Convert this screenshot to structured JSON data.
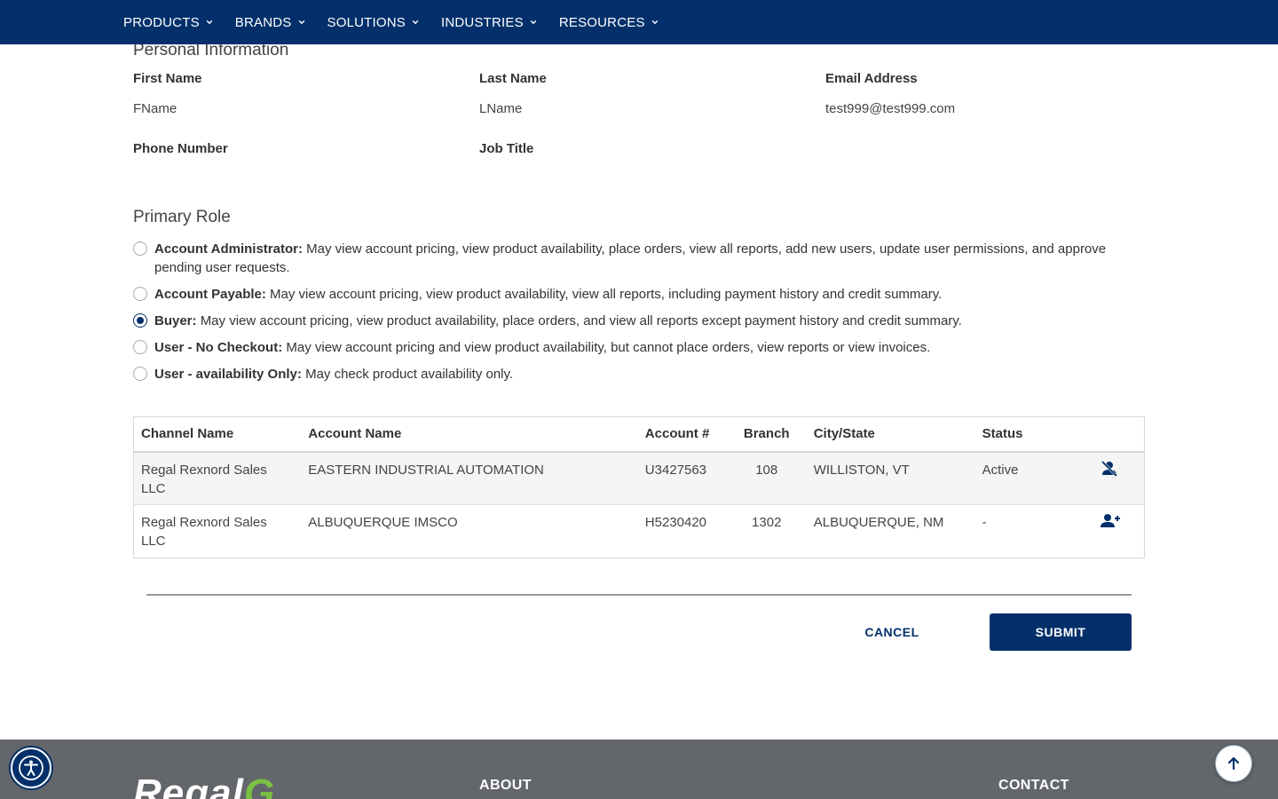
{
  "nav": {
    "items": [
      "PRODUCTS",
      "BRANDS",
      "SOLUTIONS",
      "INDUSTRIES",
      "RESOURCES"
    ]
  },
  "personal": {
    "title": "Personal Information",
    "first_name_label": "First Name",
    "first_name_value": "FName",
    "last_name_label": "Last Name",
    "last_name_value": "LName",
    "email_label": "Email Address",
    "email_value": "test999@test999.com",
    "phone_label": "Phone Number",
    "job_title_label": "Job Title"
  },
  "roles": {
    "title": "Primary Role",
    "selected": 2,
    "items": [
      {
        "name": "Account Administrator:",
        "desc": "May view account pricing, view product availability, place orders, view all reports, add new users, update user permissions, and approve pending user requests."
      },
      {
        "name": "Account Payable:",
        "desc": "May view account pricing, view product availability, view all reports, including payment history and credit summary."
      },
      {
        "name": "Buyer:",
        "desc": "May view account pricing, view product availability, place orders, and view all reports except payment history and credit summary."
      },
      {
        "name": "User - No Checkout:",
        "desc": "May view account pricing and view product availability, but cannot place orders, view reports or view invoices."
      },
      {
        "name": "User - availability Only:",
        "desc": "May check product availability only."
      }
    ]
  },
  "table": {
    "headers": [
      "Channel Name",
      "Account Name",
      "Account #",
      "Branch",
      "City/State",
      "Status"
    ],
    "rows": [
      {
        "channel": "Regal Rexnord Sales LLC",
        "account_name": "EASTERN INDUSTRIAL AUTOMATION",
        "account_no": "U3427563",
        "branch": "108",
        "city_state": "WILLISTON, VT",
        "status": "Active",
        "action_icon": "remove-user-icon"
      },
      {
        "channel": "Regal Rexnord Sales LLC",
        "account_name": "ALBUQUERQUE IMSCO",
        "account_no": "H5230420",
        "branch": "1302",
        "city_state": "ALBUQUERQUE, NM",
        "status": "-",
        "action_icon": "add-user-icon"
      }
    ]
  },
  "actions": {
    "cancel": "CANCEL",
    "submit": "SUBMIT"
  },
  "footer": {
    "logo_text": "Regal",
    "logo_mark": "G",
    "about": "ABOUT",
    "contact": "CONTACT"
  },
  "colors": {
    "brand_navy": "#03306b",
    "footer_gray": "#63666a",
    "logo_green": "#7ac143"
  }
}
